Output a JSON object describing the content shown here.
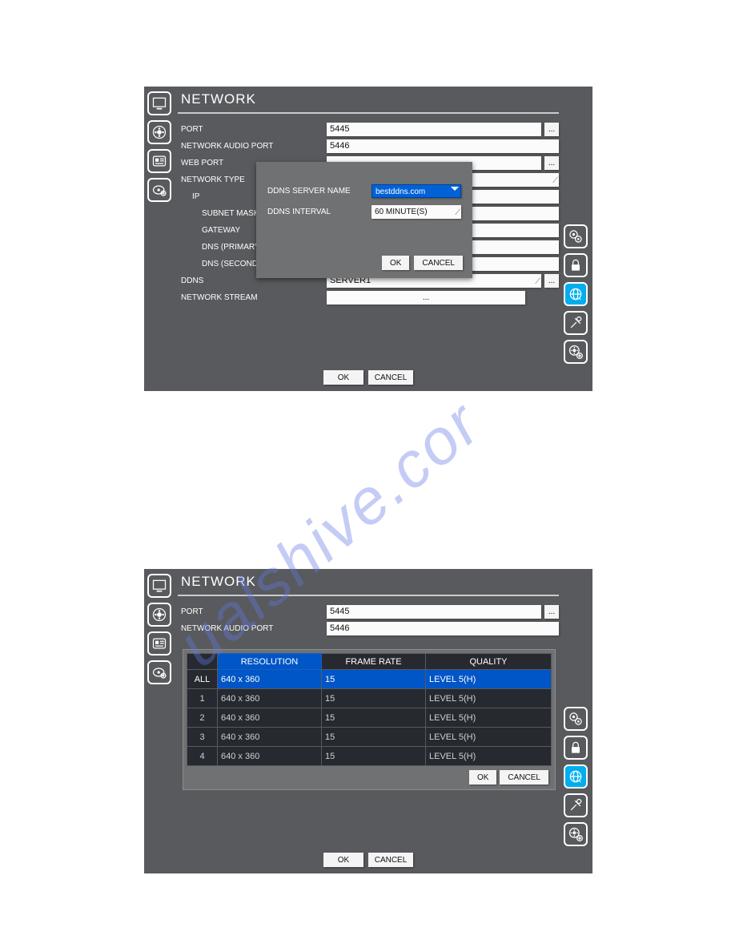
{
  "watermark": "ualshive.cor",
  "panels": {
    "title": "NETWORK",
    "buttons": {
      "ok": "OK",
      "cancel": "CANCEL",
      "more": "..."
    }
  },
  "top": {
    "rows": {
      "port_label": "PORT",
      "port_value": "5445",
      "audio_label": "NETWORK AUDIO PORT",
      "audio_value": "5446",
      "web_label": "WEB PORT",
      "web_value": "",
      "ntype_label": "NETWORK TYPE",
      "ntype_value": "",
      "ip_label": "IP",
      "ip_value": "",
      "subnet_label": "SUBNET MASK",
      "subnet_value": "",
      "gateway_label": "GATEWAY",
      "gateway_value": "",
      "dns1_label": "DNS (PRIMARY)",
      "dns1_value": "",
      "dns2_label": "DNS (SECONDARY)",
      "dns2_value": "",
      "ddns_label": "DDNS",
      "ddns_value": "SERVER1",
      "stream_label": "NETWORK STREAM",
      "stream_value": "..."
    },
    "ddns_modal": {
      "server_label": "DDNS SERVER NAME",
      "server_value": "bestddns.com",
      "interval_label": "DDNS INTERVAL",
      "interval_value": "60 MINUTE(S)"
    }
  },
  "bottom": {
    "rows": {
      "port_label": "PORT",
      "port_value": "5445",
      "audio_label": "NETWORK AUDIO PORT",
      "audio_value": "5446"
    },
    "table": {
      "headers": {
        "ch": "",
        "res": "RESOLUTION",
        "fr": "FRAME RATE",
        "q": "QUALITY"
      },
      "rows": [
        {
          "ch": "ALL",
          "res": "640 x 360",
          "fr": "15",
          "q": "LEVEL 5(H)"
        },
        {
          "ch": "1",
          "res": "640 x 360",
          "fr": "15",
          "q": "LEVEL 5(H)"
        },
        {
          "ch": "2",
          "res": "640 x 360",
          "fr": "15",
          "q": "LEVEL 5(H)"
        },
        {
          "ch": "3",
          "res": "640 x 360",
          "fr": "15",
          "q": "LEVEL 5(H)"
        },
        {
          "ch": "4",
          "res": "640 x 360",
          "fr": "15",
          "q": "LEVEL 5(H)"
        }
      ]
    }
  }
}
